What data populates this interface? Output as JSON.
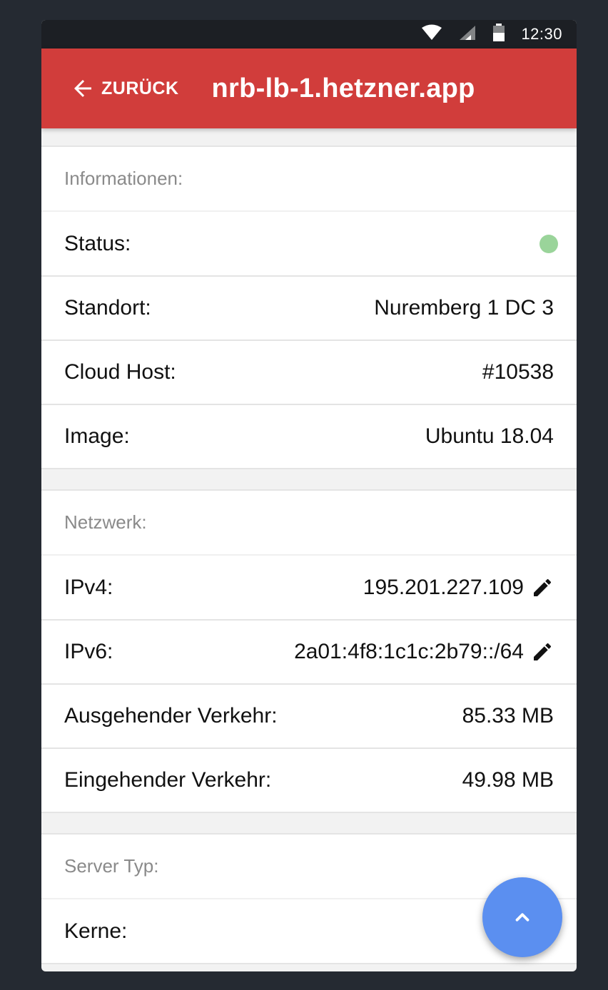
{
  "statusbar": {
    "time": "12:30",
    "icons": [
      "wifi-icon",
      "signal-icon",
      "battery-icon"
    ]
  },
  "appbar": {
    "back_label": "ZURÜCK",
    "title": "nrb-lb-1.hetzner.app",
    "color": "#d13d3b"
  },
  "sections": {
    "info": {
      "header": "Informationen:",
      "status_label": "Status:",
      "status_color": "#9ad49a",
      "location_label": "Standort:",
      "location_value": "Nuremberg 1 DC 3",
      "host_label": "Cloud Host:",
      "host_value": "#10538",
      "image_label": "Image:",
      "image_value": "Ubuntu 18.04"
    },
    "network": {
      "header": "Netzwerk:",
      "ipv4_label": "IPv4:",
      "ipv4_value": "195.201.227.109",
      "ipv6_label": "IPv6:",
      "ipv6_value": "2a01:4f8:1c1c:2b79::/64",
      "outgoing_label": "Ausgehender Verkehr:",
      "outgoing_value": "85.33 MB",
      "incoming_label": "Eingehender Verkehr:",
      "incoming_value": "49.98 MB"
    },
    "server_type": {
      "header": "Server Typ:",
      "cores_label": "Kerne:"
    }
  },
  "fab": {
    "icon": "chevron-up-icon",
    "color": "#5b8ff0"
  }
}
